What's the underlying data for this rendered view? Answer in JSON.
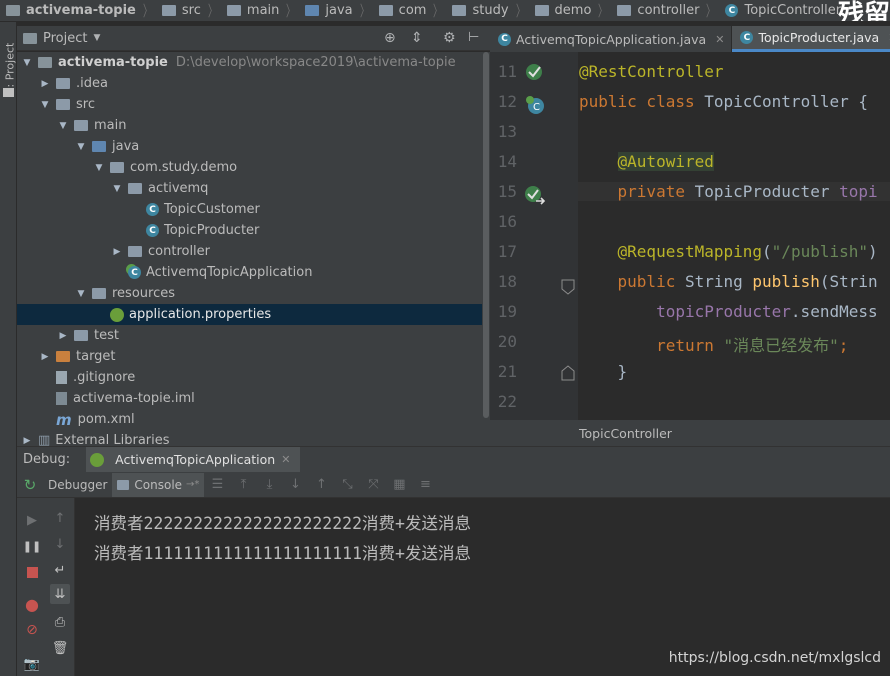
{
  "breadcrumb": [
    {
      "label": "activema-topie",
      "icon": "project-folder-icon"
    },
    {
      "label": "src",
      "icon": "folder-icon"
    },
    {
      "label": "main",
      "icon": "folder-icon"
    },
    {
      "label": "java",
      "icon": "source-folder-icon"
    },
    {
      "label": "com",
      "icon": "package-icon"
    },
    {
      "label": "study",
      "icon": "package-icon"
    },
    {
      "label": "demo",
      "icon": "package-icon"
    },
    {
      "label": "controller",
      "icon": "package-icon"
    },
    {
      "label": "TopicController",
      "icon": "class-icon"
    }
  ],
  "watermark_top": "残留",
  "sidebar_strip_label": "1: Project",
  "project_panel": {
    "title": "Project",
    "tree": [
      {
        "label": "activema-topie",
        "path": "D:\\develop\\workspace2019\\activema-topie",
        "indent": 0,
        "arrow": "down",
        "icon": "project-folder-icon",
        "bold": true
      },
      {
        "label": ".idea",
        "indent": 1,
        "arrow": "right",
        "icon": "folder-icon"
      },
      {
        "label": "src",
        "indent": 1,
        "arrow": "down",
        "icon": "folder-icon"
      },
      {
        "label": "main",
        "indent": 2,
        "arrow": "down",
        "icon": "folder-icon"
      },
      {
        "label": "java",
        "indent": 3,
        "arrow": "down",
        "icon": "source-folder-icon"
      },
      {
        "label": "com.study.demo",
        "indent": 4,
        "arrow": "down",
        "icon": "package-icon"
      },
      {
        "label": "activemq",
        "indent": 5,
        "arrow": "down",
        "icon": "package-icon"
      },
      {
        "label": "TopicCustomer",
        "indent": 6,
        "arrow": "",
        "icon": "class-icon"
      },
      {
        "label": "TopicProducter",
        "indent": 6,
        "arrow": "",
        "icon": "class-icon"
      },
      {
        "label": "controller",
        "indent": 5,
        "arrow": "right",
        "icon": "package-icon"
      },
      {
        "label": "ActivemqTopicApplication",
        "indent": 5,
        "arrow": "",
        "icon": "spring-class-icon"
      },
      {
        "label": "resources",
        "indent": 3,
        "arrow": "down",
        "icon": "resources-folder-icon"
      },
      {
        "label": "application.properties",
        "indent": 4,
        "arrow": "",
        "icon": "spring-properties-icon",
        "selected": true
      },
      {
        "label": "test",
        "indent": 2,
        "arrow": "right",
        "icon": "folder-icon"
      },
      {
        "label": "target",
        "indent": 1,
        "arrow": "right",
        "icon": "excluded-folder-icon"
      },
      {
        "label": ".gitignore",
        "indent": 1,
        "arrow": "",
        "icon": "file-icon"
      },
      {
        "label": "activema-topie.iml",
        "indent": 1,
        "arrow": "",
        "icon": "iml-file-icon"
      },
      {
        "label": "pom.xml",
        "indent": 1,
        "arrow": "",
        "icon": "maven-icon"
      },
      {
        "label": "External Libraries",
        "indent": 0,
        "arrow": "right",
        "icon": "libraries-icon"
      }
    ]
  },
  "editor": {
    "tabs": [
      {
        "label": "ActivemqTopicApplication.java",
        "active": false
      },
      {
        "label": "TopicProducter.java",
        "active": true
      }
    ],
    "line_numbers": [
      "11",
      "12",
      "13",
      "14",
      "15",
      "16",
      "17",
      "18",
      "19",
      "20",
      "21",
      "22"
    ],
    "code_lines": [
      [
        {
          "t": "@RestController",
          "c": "an"
        }
      ],
      [
        {
          "t": "public class ",
          "c": "kw"
        },
        {
          "t": "TopicController {",
          "c": ""
        }
      ],
      [],
      [
        {
          "t": "    ",
          "c": ""
        },
        {
          "t": "@Autowired",
          "c": "an hl"
        }
      ],
      [
        {
          "t": "    ",
          "c": ""
        },
        {
          "t": "private ",
          "c": "kw"
        },
        {
          "t": "TopicProducter ",
          "c": ""
        },
        {
          "t": "topi",
          "c": "fi"
        }
      ],
      [],
      [
        {
          "t": "    ",
          "c": ""
        },
        {
          "t": "@RequestMapping",
          "c": "an"
        },
        {
          "t": "(",
          "c": ""
        },
        {
          "t": "\"/publish\"",
          "c": "st"
        },
        {
          "t": ")",
          "c": ""
        }
      ],
      [
        {
          "t": "    ",
          "c": ""
        },
        {
          "t": "public ",
          "c": "kw"
        },
        {
          "t": "String ",
          "c": ""
        },
        {
          "t": "publish",
          "c": "fn"
        },
        {
          "t": "(Strin",
          "c": ""
        }
      ],
      [
        {
          "t": "        ",
          "c": ""
        },
        {
          "t": "topicProducter",
          "c": "fi"
        },
        {
          "t": ".sendMess",
          "c": ""
        }
      ],
      [
        {
          "t": "        ",
          "c": ""
        },
        {
          "t": "return ",
          "c": "kw"
        },
        {
          "t": "\"消息已经发布\"",
          "c": "st"
        },
        {
          "t": ";",
          "c": "kw"
        }
      ],
      [
        {
          "t": "    }",
          "c": ""
        }
      ],
      []
    ],
    "breadcrumb_footer": "TopicController"
  },
  "debug": {
    "label": "Debug:",
    "session_tab": "ActivemqTopicApplication",
    "tabs": [
      "Debugger",
      "Console"
    ],
    "console_lines": [
      "消费者2222222222222222222222消费+发送消息",
      "消费者1111111111111111111111消费+发送消息"
    ]
  },
  "watermark_url": "https://blog.csdn.net/mxlgslcd",
  "colors": {
    "accent": "#4a88c7",
    "selection": "#0d293e",
    "keyword": "#cc7832",
    "annotation": "#bbb529",
    "string": "#6a8759"
  }
}
